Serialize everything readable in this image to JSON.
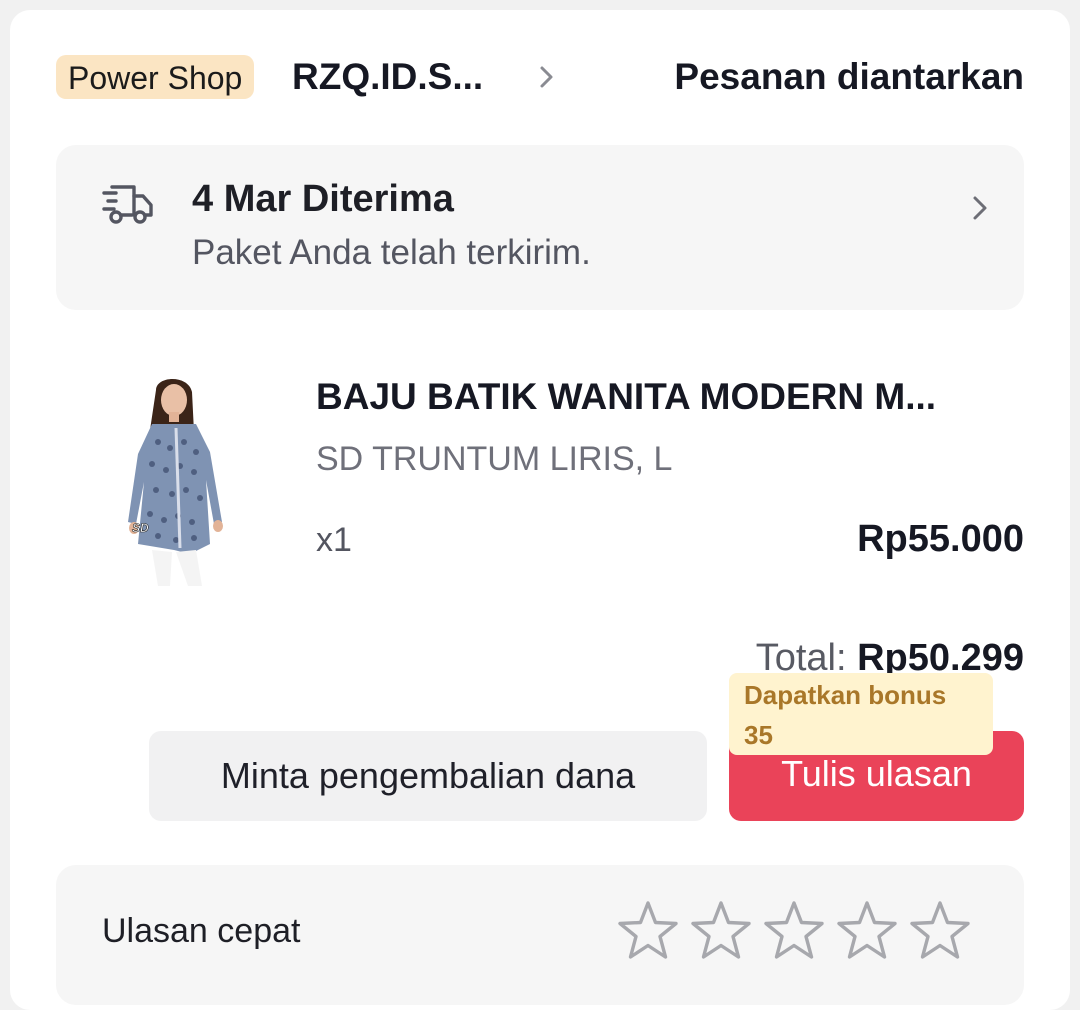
{
  "header": {
    "badge": "Power Shop",
    "shop_name": "RZQ.ID.S...",
    "order_status": "Pesanan diantarkan"
  },
  "delivery": {
    "title": "4 Mar Diterima",
    "subtitle": "Paket Anda telah terkirim."
  },
  "product": {
    "name": "BAJU BATIK WANITA MODERN M...",
    "variant": "SD TRUNTUM LIRIS, L",
    "quantity": "x1",
    "price": "Rp55.000"
  },
  "total": {
    "label": "Total:",
    "value": "Rp50.299"
  },
  "actions": {
    "refund_label": "Minta pengembalian dana",
    "review_label": "Tulis ulasan",
    "bonus_label": "Dapatkan bonus",
    "bonus_value": "35"
  },
  "quick_review": {
    "label": "Ulasan cepat",
    "stars_total": 5,
    "stars_selected": 0
  },
  "colors": {
    "accent": "#ea4359",
    "badge_bg": "#fbe5c3",
    "bonus_bg": "#fff3cf",
    "bonus_text": "#a97729"
  }
}
